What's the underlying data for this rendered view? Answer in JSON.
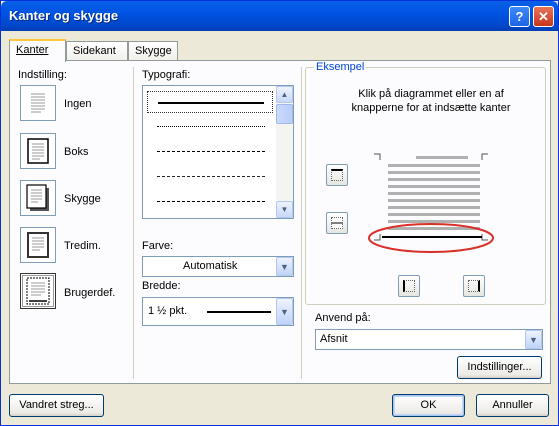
{
  "window": {
    "title": "Kanter og skygge"
  },
  "title_buttons": {
    "help": "?",
    "close": "✕"
  },
  "tabs": [
    {
      "label": "Kanter",
      "active": true
    },
    {
      "label": "Sidekant",
      "active": false
    },
    {
      "label": "Skygge",
      "active": false
    }
  ],
  "settings": {
    "heading": "Indstilling:",
    "items": [
      {
        "label": "Ingen",
        "icon": "border-none-icon"
      },
      {
        "label": "Boks",
        "icon": "border-box-icon"
      },
      {
        "label": "Skygge",
        "icon": "border-shadow-icon"
      },
      {
        "label": "Tredim.",
        "icon": "border-3d-icon"
      },
      {
        "label": "Brugerdef.",
        "icon": "border-custom-icon",
        "selected": true
      }
    ]
  },
  "typography": {
    "heading": "Typografi:",
    "styles": [
      "solid",
      "dotted",
      "dashed",
      "dash-dot",
      "long-dash"
    ]
  },
  "color": {
    "heading": "Farve:",
    "value": "Automatisk"
  },
  "width": {
    "heading": "Bredde:",
    "value": "1 ½ pkt."
  },
  "preview": {
    "heading": "Eksempel",
    "instructions": "Klik på diagrammet eller en af knapperne for at indsætte kanter"
  },
  "apply_to": {
    "heading": "Anvend på:",
    "value": "Afsnit"
  },
  "buttons": {
    "options": "Indstillinger...",
    "horizontal_line": "Vandret streg...",
    "ok": "OK",
    "cancel": "Annuller"
  },
  "colors": {
    "title_bar": "#0054e3",
    "accent": "#0046d5",
    "highlight_ring": "#d9302a"
  }
}
